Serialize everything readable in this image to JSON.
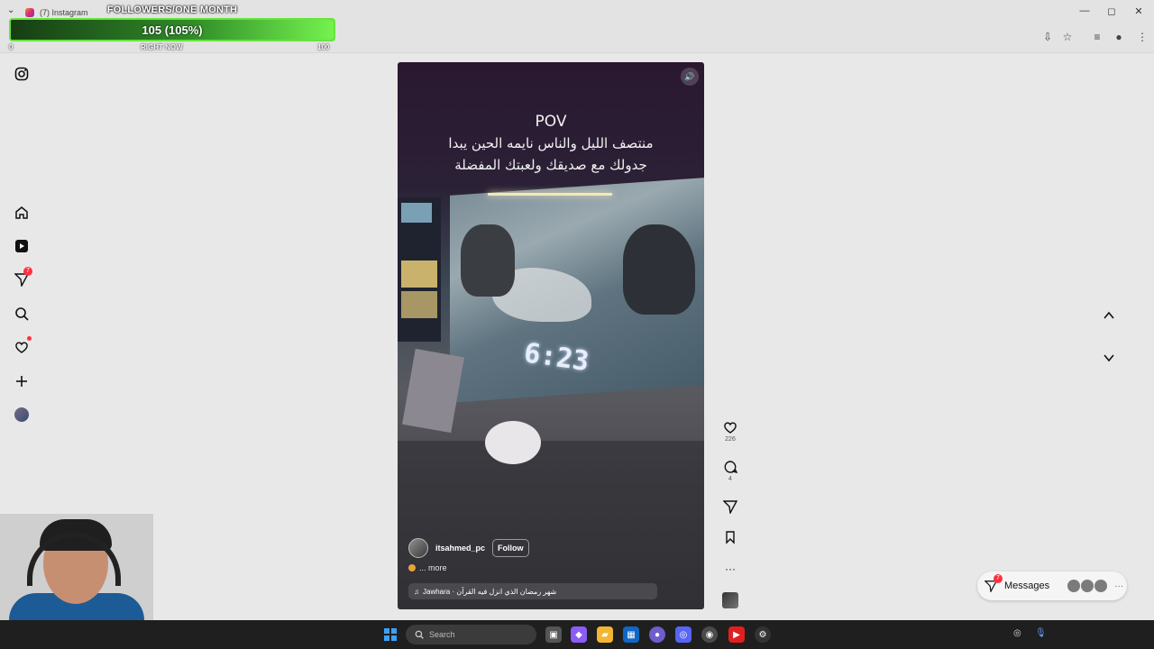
{
  "browser": {
    "tab_title": "(7) Instagram",
    "controls": [
      "—",
      "◻",
      "✕"
    ]
  },
  "overlay": {
    "title": "FOLLOWERS/ONE MONTH",
    "progress_text": "105 (105%)",
    "progress_fraction": 1.05,
    "scale_left": "0",
    "scale_mid": "RIGHT NOW",
    "scale_right": "100"
  },
  "sidebar": {
    "notifications_badge": "7"
  },
  "reel": {
    "overlay_lines": [
      "POV",
      "منتصف الليل والناس نايمه الحين يبدا",
      "جدولك مع صديقك ولعبتك المفضلة"
    ],
    "username": "itsahmed_pc",
    "follow_label": "Follow",
    "more_text": "... more",
    "audio_text": "Jawhara · شهر رمضان الذي انزل فيه القرآن",
    "clock_text": "6:23"
  },
  "actions": {
    "likes": "226",
    "comments": "4"
  },
  "messages": {
    "label": "Messages",
    "badge": "7"
  },
  "taskbar": {
    "search_placeholder": "Search"
  }
}
